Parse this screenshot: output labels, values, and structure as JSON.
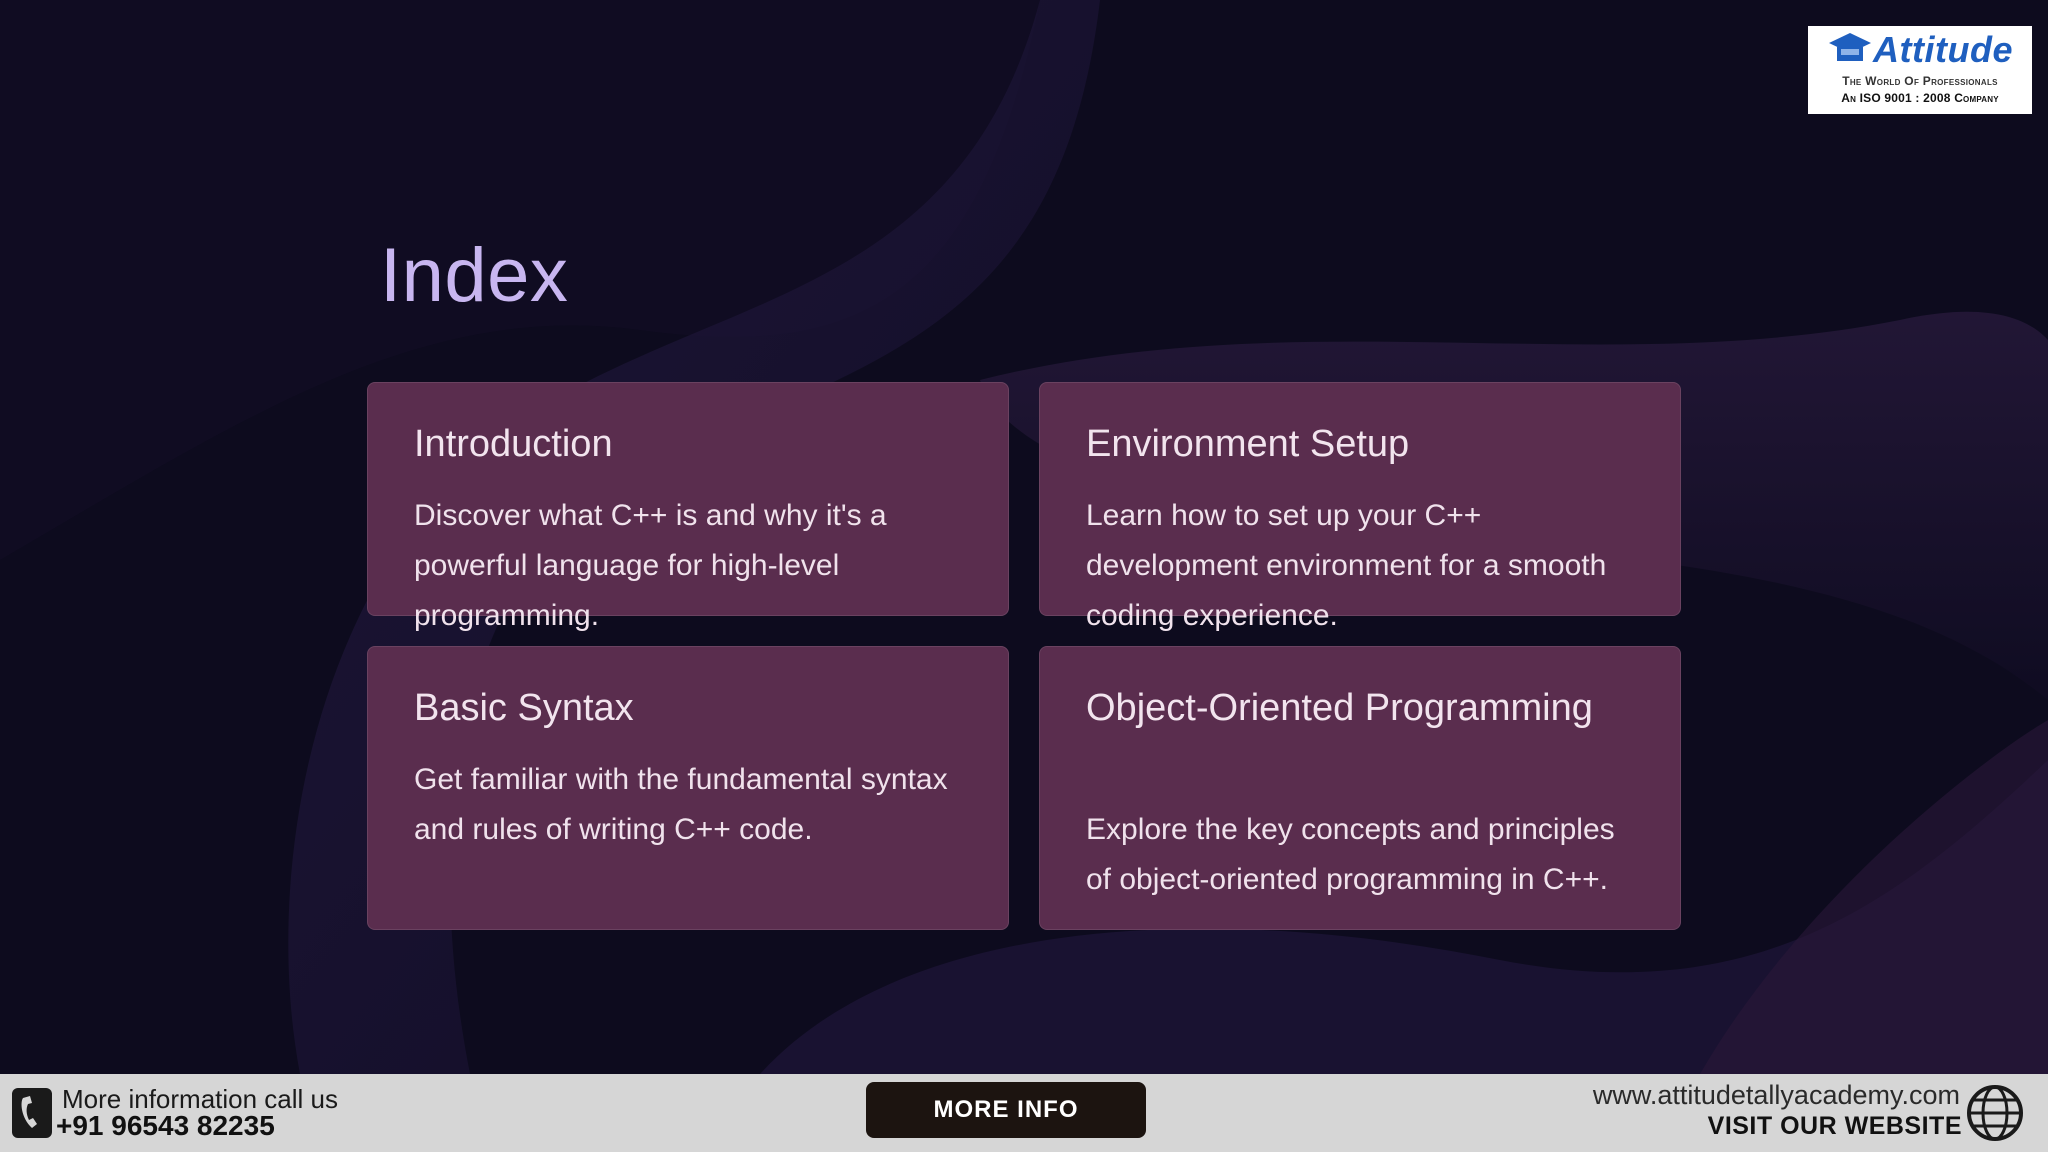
{
  "logo": {
    "word": "Attitude",
    "tagline": "The World Of Professionals",
    "iso": "An ISO 9001 : 2008 Company"
  },
  "slide": {
    "title": "Index",
    "cards": [
      {
        "title": "Introduction",
        "description": "Discover what C++ is and why it's a powerful language for high-level programming."
      },
      {
        "title": "Environment Setup",
        "description": "Learn how to set up your C++ development environment for a smooth coding experience."
      },
      {
        "title": "Basic Syntax",
        "description": "Get familiar with the fundamental syntax and rules of writing C++ code."
      },
      {
        "title": "Object-Oriented Programming",
        "description": "Explore the key concepts and principles of object-oriented programming in C++."
      }
    ]
  },
  "footer": {
    "call_label": "More information call us",
    "phone": "+91 96543 82235",
    "more_info": "MORE INFO",
    "website": "www.attitudetallyacademy.com",
    "visit": "VISIT OUR WEBSITE"
  },
  "icons": {
    "phone": "phone-icon",
    "globe": "globe-icon",
    "logo": "graduation-cap-icon"
  },
  "colors": {
    "card": "#5a2d4e",
    "title": "#c8b6f0",
    "button": "#1c1410",
    "brand": "#1f5fbf"
  }
}
